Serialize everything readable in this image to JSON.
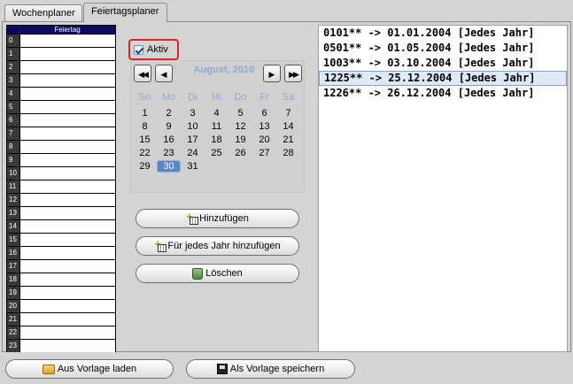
{
  "tabs": [
    {
      "label": "Wochenplaner",
      "active": false
    },
    {
      "label": "Feiertagsplaner",
      "active": true
    }
  ],
  "grid": {
    "header": "Feiertag",
    "hours": [
      "0",
      "1",
      "2",
      "3",
      "4",
      "5",
      "6",
      "7",
      "8",
      "9",
      "10",
      "11",
      "12",
      "13",
      "14",
      "15",
      "16",
      "17",
      "18",
      "19",
      "20",
      "21",
      "22",
      "23"
    ]
  },
  "aktiv": {
    "label": "Aktiv",
    "checked": true
  },
  "calendar": {
    "month_label": "August, 2010",
    "weekdays": [
      "So",
      "Mo",
      "Di",
      "Mi",
      "Do",
      "Fr",
      "Sa"
    ],
    "weeks": [
      [
        "1",
        "2",
        "3",
        "4",
        "5",
        "6",
        "7"
      ],
      [
        "8",
        "9",
        "10",
        "11",
        "12",
        "13",
        "14"
      ],
      [
        "15",
        "16",
        "17",
        "18",
        "19",
        "20",
        "21"
      ],
      [
        "22",
        "23",
        "24",
        "25",
        "26",
        "27",
        "28"
      ],
      [
        "29",
        "30",
        "31",
        "",
        "",
        "",
        ""
      ]
    ],
    "selected_day": "30",
    "nav": {
      "first": "◀◀",
      "prev": "◀",
      "next": "▶",
      "last": "▶▶"
    }
  },
  "actions": {
    "add": "Hinzufügen",
    "add_yearly": "Für jedes Jahr hinzufügen",
    "delete": "Löschen"
  },
  "holidays": [
    {
      "text": "0101** -> 01.01.2004 [Jedes Jahr]",
      "selected": false
    },
    {
      "text": "0501** -> 01.05.2004 [Jedes Jahr]",
      "selected": false
    },
    {
      "text": "1003** -> 03.10.2004 [Jedes Jahr]",
      "selected": false
    },
    {
      "text": "1225** -> 25.12.2004 [Jedes Jahr]",
      "selected": true
    },
    {
      "text": "1226** -> 26.12.2004 [Jedes Jahr]",
      "selected": false
    }
  ],
  "footer": {
    "load_template": "Aus Vorlage laden",
    "save_template": "Als Vorlage speichern"
  },
  "icons": {
    "add": "add-icon",
    "add_yearly": "add-yearly-icon",
    "delete": "recycle-bin-icon",
    "load": "folder-open-icon",
    "save": "floppy-disk-icon"
  }
}
